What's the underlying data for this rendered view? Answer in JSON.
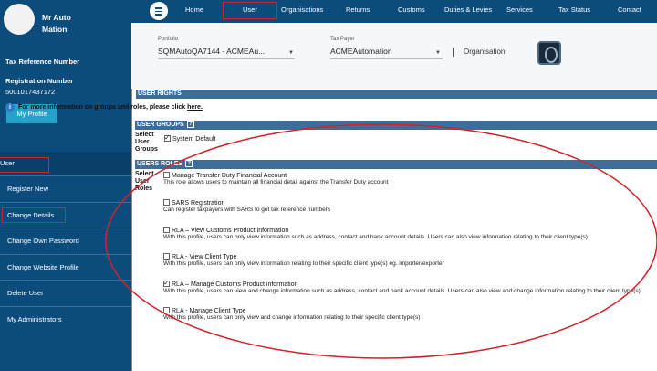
{
  "sidebar": {
    "user_name": "Mr Auto\nMation",
    "tax_ref_heading": "Tax Reference Number",
    "reg_heading": "Registration Number",
    "reg_number": "5001017437172",
    "profile_button": "My Profile",
    "items": [
      {
        "label": "User"
      },
      {
        "label": "Register New"
      },
      {
        "label": "Change Details"
      },
      {
        "label": "Change Own Password"
      },
      {
        "label": "Change Website Profile"
      },
      {
        "label": "Delete User"
      },
      {
        "label": "My Administrators"
      }
    ]
  },
  "topnav": {
    "tabs": [
      "Home",
      "User",
      "Organisations",
      "Returns",
      "Customs",
      "Duties & Levies",
      "Services",
      "Tax Status",
      "Contact"
    ]
  },
  "header": {
    "portfolio_label": "Portfolio",
    "portfolio_value": "SQMAutoQA7144 - ACMEAu...",
    "taxpayer_label": "Tax Payer",
    "taxpayer_value": "ACMEAutomation",
    "org_label": "Organisation"
  },
  "content": {
    "user_rights_heading": "USER RIGHTS",
    "info_text": "For more information on groups and roles, please click",
    "info_link": "here.",
    "user_groups_heading": "USER GROUPS",
    "select_groups_label": "Select User Groups",
    "group_option": "System Default",
    "roles_heading": "USERS ROLES",
    "select_roles_label": "Select User Roles",
    "roles": [
      {
        "title": "Manage Transfer Duty Financial Account",
        "desc": "This role allows users to maintain all financial detail against the Transfer Duty account",
        "checked": false
      },
      {
        "title": "SARS Registration",
        "desc": "Can register taxpayers with SARS to get tax reference numbers",
        "checked": false
      },
      {
        "title": "RLA – View Customs Product information",
        "desc": "With this profile, users can only view information such as address, contact and bank account details. Users can also view information relating to their client type(s)",
        "checked": false
      },
      {
        "title": "RLA - View Client Type",
        "desc": "With this profile, users can only view information relating to their specific client type(s) eg. importer/exporter",
        "checked": false
      },
      {
        "title": "RLA – Manage Customs Product information",
        "desc": "With this profile, users can view and change information such as address, contact and bank account details. Users can also view and change information relating to their client type(s)",
        "checked": true
      },
      {
        "title": "RLA - Manage Client Type",
        "desc": "With this profile, users can only view and change information relating to their specific client type(s)",
        "checked": false
      }
    ]
  },
  "colors": {
    "nav_bg": "#0c4c7d",
    "section_bar": "#3f6d99",
    "annotation_red": "#d0232a",
    "button": "#26a3c9"
  }
}
